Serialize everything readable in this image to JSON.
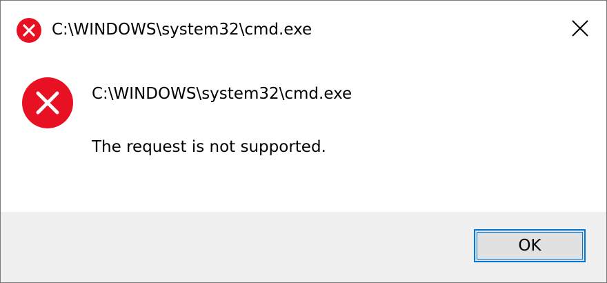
{
  "window": {
    "title": "C:\\WINDOWS\\system32\\cmd.exe",
    "title_icon": "error-icon",
    "close_icon": "close-icon"
  },
  "message": {
    "icon": "error-icon",
    "heading": "C:\\WINDOWS\\system32\\cmd.exe",
    "body": "The request is not supported."
  },
  "buttons": {
    "ok_label": "OK"
  },
  "colors": {
    "error_red": "#e81123",
    "button_focus": "#0078d7",
    "footer_bg": "#f0f0f0"
  }
}
